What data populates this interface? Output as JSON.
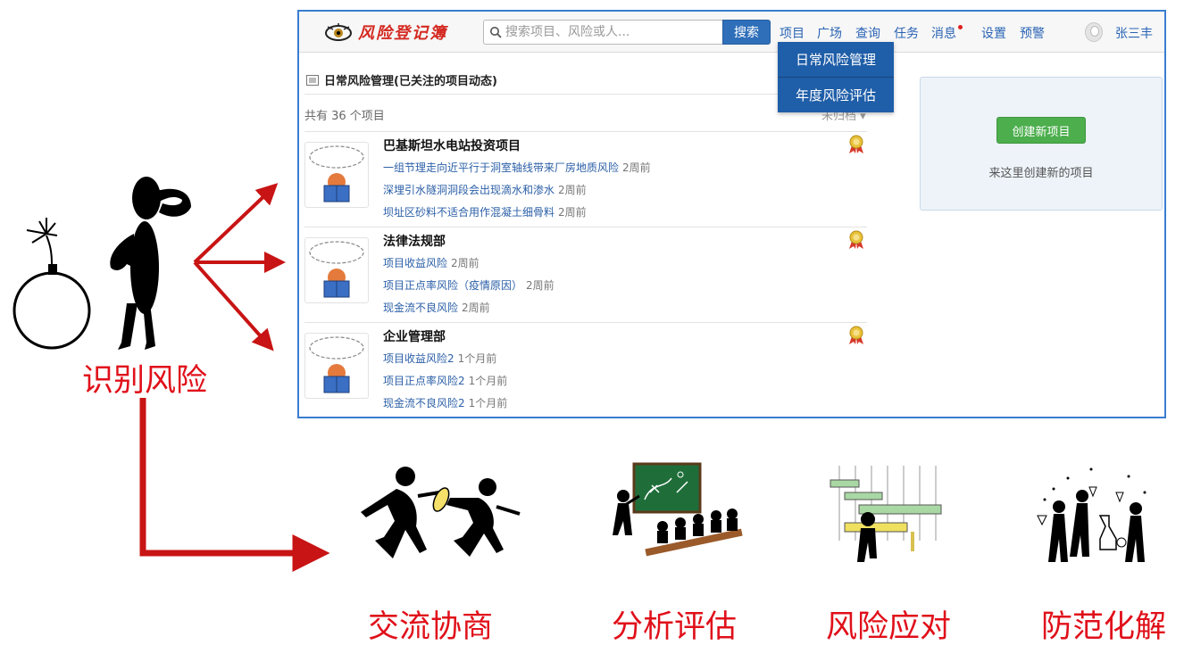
{
  "app": {
    "logo_text": "风险登记簿",
    "search_placeholder": "搜索项目、风险或人...",
    "search_button": "搜索",
    "nav": [
      "项目",
      "广场",
      "查询",
      "任务",
      "消息",
      "设置",
      "预警"
    ],
    "user_name": "张三丰",
    "dropdown": [
      "日常风险管理",
      "年度风险评估"
    ],
    "section_title": "日常风险管理(已关注的项目动态)",
    "project_count_text": "共有 36 个项目",
    "sort_label": "未归档",
    "projects": [
      {
        "title": "巴基斯坦水电站投资项目",
        "risks": [
          {
            "text": "一组节理走向近平行于洞室轴线带来厂房地质风险",
            "time": "2周前"
          },
          {
            "text": "深埋引水隧洞洞段会出现滴水和渗水",
            "time": "2周前"
          },
          {
            "text": "坝址区砂料不适合用作混凝土细骨料",
            "time": "2周前"
          }
        ]
      },
      {
        "title": "法律法规部",
        "risks": [
          {
            "text": "项目收益风险",
            "time": "2周前"
          },
          {
            "text": "项目正点率风险（疫情原因）",
            "time": "2周前"
          },
          {
            "text": "现金流不良风险",
            "time": "2周前"
          }
        ]
      },
      {
        "title": "企业管理部",
        "risks": [
          {
            "text": "项目收益风险2",
            "time": "1个月前"
          },
          {
            "text": "项目正点率风险2",
            "time": "1个月前"
          },
          {
            "text": "现金流不良风险2",
            "time": "1个月前"
          }
        ]
      }
    ],
    "create_button": "创建新项目",
    "create_hint": "来这里创建新的项目"
  },
  "stages": {
    "identify": "识别风险",
    "communicate": "交流协商",
    "analyze": "分析评估",
    "respond": "风险应对",
    "prevent": "防范化解"
  },
  "colors": {
    "label_red": "#e0101a",
    "arrow_red": "#c81414",
    "app_border": "#3a7dd0",
    "link_blue": "#2a64b4",
    "dropdown_blue": "#1f5ea8",
    "button_green": "#4cae4c"
  }
}
